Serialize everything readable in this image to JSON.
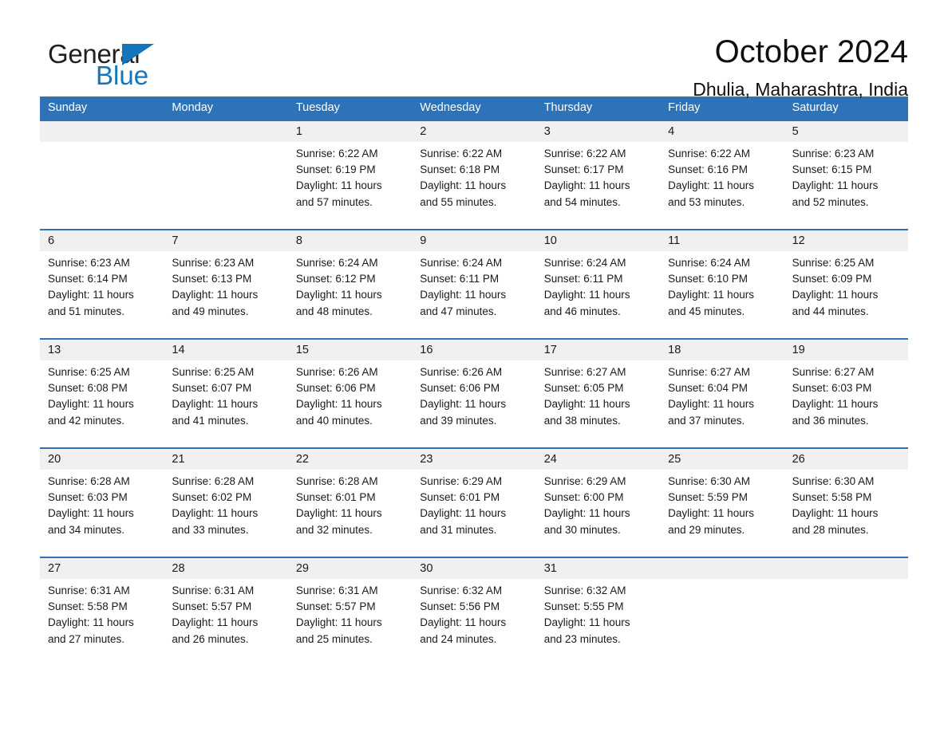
{
  "logo": {
    "word_one": "General",
    "word_two": "Blue",
    "triangle_icon": "triangle-icon",
    "brand_blue": "#1375bc"
  },
  "header": {
    "month_title": "October 2024",
    "location": "Dhulia, Maharashtra, India"
  },
  "colors": {
    "header_blue": "#2e72b8",
    "daynum_band": "#f0f0f0",
    "cell_background": "#ffffff",
    "text": "#1a1a1a"
  },
  "weekdays": [
    "Sunday",
    "Monday",
    "Tuesday",
    "Wednesday",
    "Thursday",
    "Friday",
    "Saturday"
  ],
  "weeks": [
    {
      "days": [
        {
          "num": "",
          "sunrise": "",
          "sunset": "",
          "daylight_line1": "",
          "daylight_line2": ""
        },
        {
          "num": "",
          "sunrise": "",
          "sunset": "",
          "daylight_line1": "",
          "daylight_line2": ""
        },
        {
          "num": "1",
          "sunrise": "Sunrise: 6:22 AM",
          "sunset": "Sunset: 6:19 PM",
          "daylight_line1": "Daylight: 11 hours",
          "daylight_line2": "and 57 minutes."
        },
        {
          "num": "2",
          "sunrise": "Sunrise: 6:22 AM",
          "sunset": "Sunset: 6:18 PM",
          "daylight_line1": "Daylight: 11 hours",
          "daylight_line2": "and 55 minutes."
        },
        {
          "num": "3",
          "sunrise": "Sunrise: 6:22 AM",
          "sunset": "Sunset: 6:17 PM",
          "daylight_line1": "Daylight: 11 hours",
          "daylight_line2": "and 54 minutes."
        },
        {
          "num": "4",
          "sunrise": "Sunrise: 6:22 AM",
          "sunset": "Sunset: 6:16 PM",
          "daylight_line1": "Daylight: 11 hours",
          "daylight_line2": "and 53 minutes."
        },
        {
          "num": "5",
          "sunrise": "Sunrise: 6:23 AM",
          "sunset": "Sunset: 6:15 PM",
          "daylight_line1": "Daylight: 11 hours",
          "daylight_line2": "and 52 minutes."
        }
      ]
    },
    {
      "days": [
        {
          "num": "6",
          "sunrise": "Sunrise: 6:23 AM",
          "sunset": "Sunset: 6:14 PM",
          "daylight_line1": "Daylight: 11 hours",
          "daylight_line2": "and 51 minutes."
        },
        {
          "num": "7",
          "sunrise": "Sunrise: 6:23 AM",
          "sunset": "Sunset: 6:13 PM",
          "daylight_line1": "Daylight: 11 hours",
          "daylight_line2": "and 49 minutes."
        },
        {
          "num": "8",
          "sunrise": "Sunrise: 6:24 AM",
          "sunset": "Sunset: 6:12 PM",
          "daylight_line1": "Daylight: 11 hours",
          "daylight_line2": "and 48 minutes."
        },
        {
          "num": "9",
          "sunrise": "Sunrise: 6:24 AM",
          "sunset": "Sunset: 6:11 PM",
          "daylight_line1": "Daylight: 11 hours",
          "daylight_line2": "and 47 minutes."
        },
        {
          "num": "10",
          "sunrise": "Sunrise: 6:24 AM",
          "sunset": "Sunset: 6:11 PM",
          "daylight_line1": "Daylight: 11 hours",
          "daylight_line2": "and 46 minutes."
        },
        {
          "num": "11",
          "sunrise": "Sunrise: 6:24 AM",
          "sunset": "Sunset: 6:10 PM",
          "daylight_line1": "Daylight: 11 hours",
          "daylight_line2": "and 45 minutes."
        },
        {
          "num": "12",
          "sunrise": "Sunrise: 6:25 AM",
          "sunset": "Sunset: 6:09 PM",
          "daylight_line1": "Daylight: 11 hours",
          "daylight_line2": "and 44 minutes."
        }
      ]
    },
    {
      "days": [
        {
          "num": "13",
          "sunrise": "Sunrise: 6:25 AM",
          "sunset": "Sunset: 6:08 PM",
          "daylight_line1": "Daylight: 11 hours",
          "daylight_line2": "and 42 minutes."
        },
        {
          "num": "14",
          "sunrise": "Sunrise: 6:25 AM",
          "sunset": "Sunset: 6:07 PM",
          "daylight_line1": "Daylight: 11 hours",
          "daylight_line2": "and 41 minutes."
        },
        {
          "num": "15",
          "sunrise": "Sunrise: 6:26 AM",
          "sunset": "Sunset: 6:06 PM",
          "daylight_line1": "Daylight: 11 hours",
          "daylight_line2": "and 40 minutes."
        },
        {
          "num": "16",
          "sunrise": "Sunrise: 6:26 AM",
          "sunset": "Sunset: 6:06 PM",
          "daylight_line1": "Daylight: 11 hours",
          "daylight_line2": "and 39 minutes."
        },
        {
          "num": "17",
          "sunrise": "Sunrise: 6:27 AM",
          "sunset": "Sunset: 6:05 PM",
          "daylight_line1": "Daylight: 11 hours",
          "daylight_line2": "and 38 minutes."
        },
        {
          "num": "18",
          "sunrise": "Sunrise: 6:27 AM",
          "sunset": "Sunset: 6:04 PM",
          "daylight_line1": "Daylight: 11 hours",
          "daylight_line2": "and 37 minutes."
        },
        {
          "num": "19",
          "sunrise": "Sunrise: 6:27 AM",
          "sunset": "Sunset: 6:03 PM",
          "daylight_line1": "Daylight: 11 hours",
          "daylight_line2": "and 36 minutes."
        }
      ]
    },
    {
      "days": [
        {
          "num": "20",
          "sunrise": "Sunrise: 6:28 AM",
          "sunset": "Sunset: 6:03 PM",
          "daylight_line1": "Daylight: 11 hours",
          "daylight_line2": "and 34 minutes."
        },
        {
          "num": "21",
          "sunrise": "Sunrise: 6:28 AM",
          "sunset": "Sunset: 6:02 PM",
          "daylight_line1": "Daylight: 11 hours",
          "daylight_line2": "and 33 minutes."
        },
        {
          "num": "22",
          "sunrise": "Sunrise: 6:28 AM",
          "sunset": "Sunset: 6:01 PM",
          "daylight_line1": "Daylight: 11 hours",
          "daylight_line2": "and 32 minutes."
        },
        {
          "num": "23",
          "sunrise": "Sunrise: 6:29 AM",
          "sunset": "Sunset: 6:01 PM",
          "daylight_line1": "Daylight: 11 hours",
          "daylight_line2": "and 31 minutes."
        },
        {
          "num": "24",
          "sunrise": "Sunrise: 6:29 AM",
          "sunset": "Sunset: 6:00 PM",
          "daylight_line1": "Daylight: 11 hours",
          "daylight_line2": "and 30 minutes."
        },
        {
          "num": "25",
          "sunrise": "Sunrise: 6:30 AM",
          "sunset": "Sunset: 5:59 PM",
          "daylight_line1": "Daylight: 11 hours",
          "daylight_line2": "and 29 minutes."
        },
        {
          "num": "26",
          "sunrise": "Sunrise: 6:30 AM",
          "sunset": "Sunset: 5:58 PM",
          "daylight_line1": "Daylight: 11 hours",
          "daylight_line2": "and 28 minutes."
        }
      ]
    },
    {
      "days": [
        {
          "num": "27",
          "sunrise": "Sunrise: 6:31 AM",
          "sunset": "Sunset: 5:58 PM",
          "daylight_line1": "Daylight: 11 hours",
          "daylight_line2": "and 27 minutes."
        },
        {
          "num": "28",
          "sunrise": "Sunrise: 6:31 AM",
          "sunset": "Sunset: 5:57 PM",
          "daylight_line1": "Daylight: 11 hours",
          "daylight_line2": "and 26 minutes."
        },
        {
          "num": "29",
          "sunrise": "Sunrise: 6:31 AM",
          "sunset": "Sunset: 5:57 PM",
          "daylight_line1": "Daylight: 11 hours",
          "daylight_line2": "and 25 minutes."
        },
        {
          "num": "30",
          "sunrise": "Sunrise: 6:32 AM",
          "sunset": "Sunset: 5:56 PM",
          "daylight_line1": "Daylight: 11 hours",
          "daylight_line2": "and 24 minutes."
        },
        {
          "num": "31",
          "sunrise": "Sunrise: 6:32 AM",
          "sunset": "Sunset: 5:55 PM",
          "daylight_line1": "Daylight: 11 hours",
          "daylight_line2": "and 23 minutes."
        },
        {
          "num": "",
          "sunrise": "",
          "sunset": "",
          "daylight_line1": "",
          "daylight_line2": ""
        },
        {
          "num": "",
          "sunrise": "",
          "sunset": "",
          "daylight_line1": "",
          "daylight_line2": ""
        }
      ]
    }
  ]
}
